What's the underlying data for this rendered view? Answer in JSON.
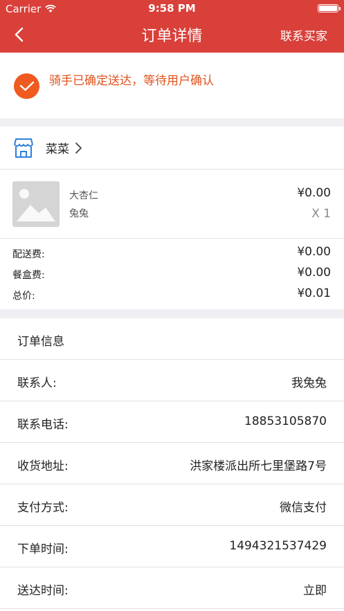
{
  "status_bar": {
    "carrier": "Carrier",
    "time": "9:58 PM"
  },
  "nav": {
    "back_icon": "chevron-left-icon",
    "title": "订单详情",
    "action": "联系买家"
  },
  "order_status": {
    "icon": "check-circle-icon",
    "text": "骑手已确定送达，等待用户确认",
    "color": "#e0541f"
  },
  "shop": {
    "icon": "shop-icon",
    "name": "菜菜"
  },
  "item": {
    "image_icon": "image-placeholder-icon",
    "name": "大杏仁",
    "spec": "兔兔",
    "price": "¥0.00",
    "quantity": "X 1"
  },
  "fees": [
    {
      "label": "配送费:",
      "value": "¥0.00"
    },
    {
      "label": "餐盒费:",
      "value": "¥0.00"
    },
    {
      "label": "总价:",
      "value": "¥0.01"
    }
  ],
  "info": {
    "title": "订单信息",
    "rows": [
      {
        "label": "联系人:",
        "value": "我兔兔"
      },
      {
        "label": "联系电话:",
        "value": "18853105870"
      },
      {
        "label": "收货地址:",
        "value": "洪家楼派出所七里堡路7号"
      },
      {
        "label": "支付方式:",
        "value": "微信支付"
      },
      {
        "label": "下单时间:",
        "value": "1494321537429"
      },
      {
        "label": "送达时间:",
        "value": "立即"
      }
    ]
  },
  "colors": {
    "brand": "#d9403a",
    "accent": "#ef5a21",
    "background": "#f0f0f4"
  }
}
